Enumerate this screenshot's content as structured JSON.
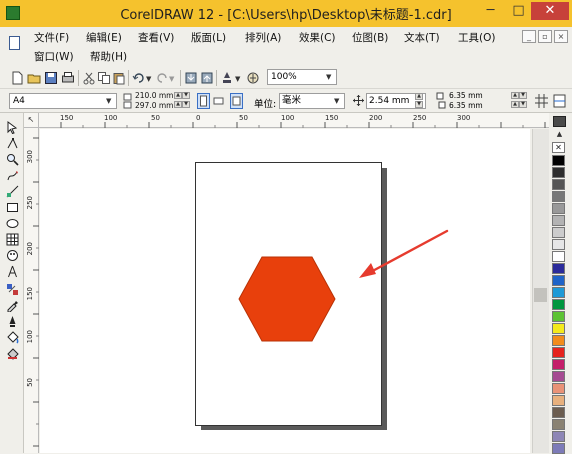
{
  "window": {
    "title": "CorelDRAW 12 - [C:\\Users\\hp\\Desktop\\未标题-1.cdr]",
    "controls": {
      "minimize": "─",
      "maximize": "□",
      "close": "✕"
    }
  },
  "menu": {
    "row1": [
      "文件(F)",
      "编辑(E)",
      "查看(V)",
      "版面(L)",
      "排列(A)",
      "效果(C)",
      "位图(B)",
      "文本(T)",
      "工具(O)"
    ],
    "row2": [
      "窗口(W)",
      "帮助(H)"
    ],
    "mdi_controls": [
      "_",
      "▫",
      "×"
    ]
  },
  "toolbar": {
    "zoom": "100%"
  },
  "property_bar": {
    "paper_size": "A4",
    "width": "210.0 mm",
    "height": "297.0 mm",
    "units_label": "单位:",
    "units_value": "毫米",
    "nudge": "2.54 mm",
    "duplicate_x": "6.35 mm",
    "duplicate_y": "6.35 mm"
  },
  "ruler": {
    "corner": "↖",
    "h_labels": [
      "150",
      "100",
      "50",
      "0",
      "50",
      "100",
      "150",
      "200",
      "250",
      "300"
    ],
    "v_labels": [
      "300",
      "250",
      "200",
      "150",
      "100",
      "50"
    ]
  },
  "palette": {
    "no_color": "✕",
    "colors": [
      "#000000",
      "#2e2e2e",
      "#555555",
      "#777777",
      "#999999",
      "#b3b3b3",
      "#cccccc",
      "#e6e6e6",
      "#ffffff",
      "#2b2b9a",
      "#1f64c8",
      "#1f9ad6",
      "#00963e",
      "#5cc233",
      "#f4ea1c",
      "#f28c1c",
      "#e5231d",
      "#c41e69",
      "#a64b92",
      "#e99277",
      "#e7b07d",
      "#6b5d50",
      "#8a8272",
      "#8e86b5",
      "#7d7bb8"
    ]
  },
  "shape": {
    "type": "hexagon",
    "fill": "#e8400c"
  },
  "annotation": {
    "arrow_color": "#e63b2e"
  }
}
